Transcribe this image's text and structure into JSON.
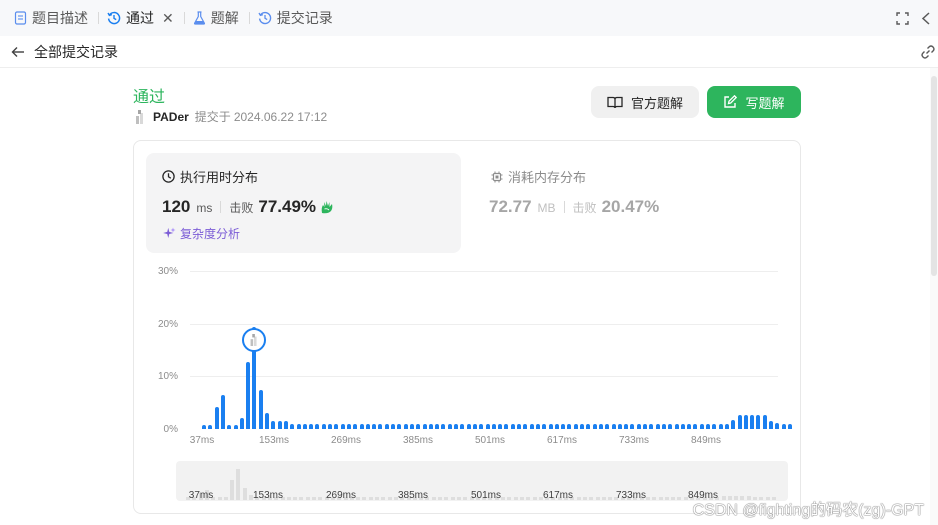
{
  "tabs": [
    {
      "label": "题目描述",
      "icon": "document-icon"
    },
    {
      "label": "通过",
      "icon": "history-icon",
      "active": true
    },
    {
      "label": "题解",
      "icon": "flask-icon"
    },
    {
      "label": "提交记录",
      "icon": "history-icon"
    }
  ],
  "subheader": {
    "title": "全部提交记录"
  },
  "submission": {
    "status": "通过",
    "user": "PADer",
    "submitted_prefix": "提交于",
    "timestamp": "2024.06.22 17:12"
  },
  "buttons": {
    "official_solution": "官方题解",
    "write_solution": "写题解"
  },
  "runtime": {
    "title": "执行用时分布",
    "value": "120",
    "unit": "ms",
    "beats_label": "击败",
    "beats_value": "77.49%",
    "complexity_label": "复杂度分析"
  },
  "memory": {
    "title": "消耗内存分布",
    "value": "72.77",
    "unit": "MB",
    "beats_label": "击败",
    "beats_value": "20.47%"
  },
  "colors": {
    "accent_green": "#2db55d",
    "bar_blue": "#1a7ff0",
    "complexity_purple": "#7b5cd6"
  },
  "chart_data": {
    "type": "bar",
    "title": "",
    "xlabel": "",
    "ylabel": "",
    "ylim": [
      0,
      30
    ],
    "y_ticks": [
      "30%",
      "20%",
      "10%",
      "0%"
    ],
    "x_tick_labels": [
      "37ms",
      "153ms",
      "269ms",
      "385ms",
      "501ms",
      "617ms",
      "733ms",
      "849ms"
    ],
    "values": [
      0.8,
      0.8,
      4.2,
      6.5,
      0.8,
      0.8,
      2.0,
      12.7,
      19.3,
      7.5,
      3.0,
      1.6,
      1.6,
      1.6,
      1.0,
      1.0,
      1.0,
      1.0,
      1.0,
      1.0,
      1.0,
      1.0,
      1.0,
      1.0,
      1.0,
      1.0,
      1.0,
      1.0,
      1.0,
      1.0,
      1.0,
      1.0,
      1.0,
      1.0,
      1.0,
      1.0,
      1.0,
      1.0,
      1.0,
      1.0,
      1.0,
      1.0,
      1.0,
      1.0,
      1.0,
      1.0,
      1.0,
      1.0,
      1.0,
      1.0,
      1.0,
      1.0,
      1.0,
      1.0,
      1.0,
      1.0,
      1.0,
      1.0,
      1.0,
      1.0,
      1.0,
      1.0,
      1.0,
      1.0,
      1.0,
      1.0,
      1.0,
      1.0,
      1.0,
      1.0,
      1.0,
      1.0,
      1.0,
      1.0,
      1.0,
      1.0,
      1.0,
      1.0,
      1.0,
      1.0,
      1.0,
      1.0,
      1.0,
      1.0,
      1.8,
      2.6,
      2.6,
      2.6,
      2.6,
      2.6,
      1.6,
      1.2,
      1.0,
      1.0
    ],
    "highlight_index": 8,
    "grid": true
  },
  "watermark": "CSDN @fighting的码农(zg)-GPT"
}
